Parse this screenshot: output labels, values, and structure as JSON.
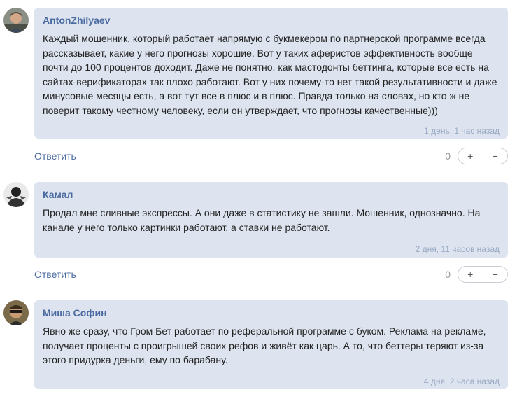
{
  "comments": [
    {
      "author": "AntonZhilyaev",
      "text": "Каждый мошенник, который работает напрямую с букмекером по партнерской программе всегда рассказывает, какие у него прогнозы хорошие. Вот у таких аферистов эффективность вообще почти до 100 процентов доходит. Даже не понятно, как мастодонты беттинга, которые все есть на сайтах-верификаторах так плохо работают. Вот у них почему-то нет такой результативности и даже минусовые месяцы есть, а вот тут все в плюс и в плюс. Правда только на словах, но кто ж не поверит такому честному человеку, если он утверждает, что прогнозы качественные)))",
      "date": "1 день, 1 час назад",
      "reply": "Ответить",
      "score": "0",
      "plus": "+",
      "minus": "−"
    },
    {
      "author": "Камал",
      "text": "Продал мне сливные экспрессы. А они даже в статистику не зашли. Мошенник, однозначно. На канале у него только картинки работают, а ставки не работают.",
      "date": "2 дня, 11 часов назад",
      "reply": "Ответить",
      "score": "0",
      "plus": "+",
      "minus": "−"
    },
    {
      "author": "Миша Софин",
      "text": "Явно же сразу, что Гром Бет работает по реферальной программе с буком. Реклама на рекламе, получает проценты с проигрышей своих рефов и живёт как царь. А то, что беттеры теряют из-за этого придурка деньги, ему по барабану.",
      "date": "4 дня, 2 часа назад"
    }
  ],
  "colors": {
    "bubble_bg": "#dde4ef",
    "author": "#4a6aa0",
    "date": "#9aaac4"
  }
}
